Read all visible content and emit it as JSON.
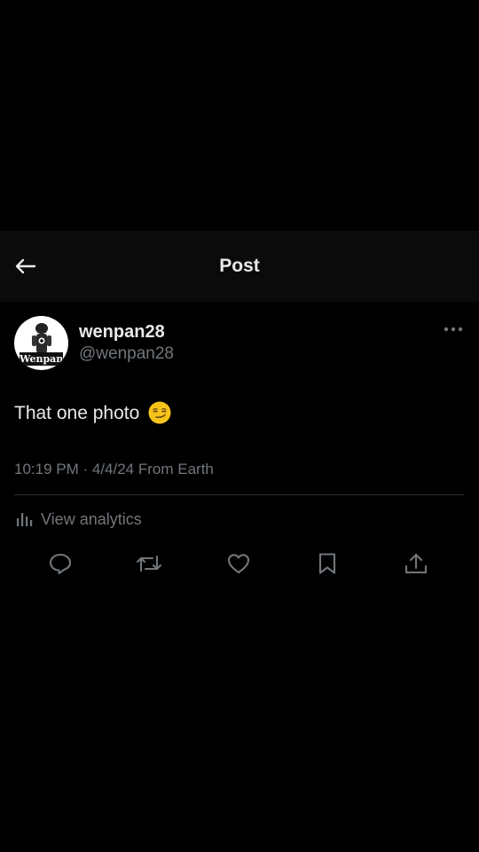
{
  "header": {
    "title": "Post"
  },
  "post": {
    "avatar_text": "Wenpan",
    "display_name": "wenpan28",
    "handle": "@wenpan28",
    "text": "That one photo",
    "emoji": "smirking-face",
    "meta": "10:19 PM · 4/4/24 From Earth"
  },
  "analytics": {
    "label": "View analytics"
  },
  "actions": [
    "reply-icon",
    "repost-icon",
    "like-icon",
    "bookmark-icon",
    "share-icon"
  ],
  "colors": {
    "background": "#000000",
    "header_background": "#0b0b0b",
    "primary_text": "#e7e9ea",
    "secondary_text": "#71767b",
    "divider": "#2f3336",
    "emoji": "#f7c31b"
  }
}
